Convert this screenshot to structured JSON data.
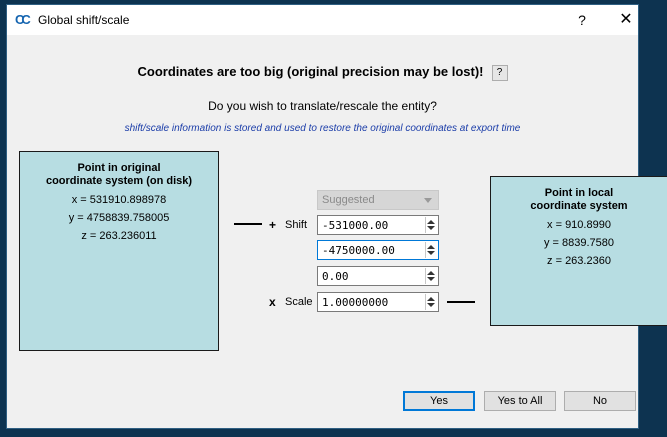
{
  "window": {
    "title": "Global shift/scale",
    "help_label": "?",
    "close_label": "✕",
    "icon": "cloudcompare-logo-icon"
  },
  "header": {
    "headline": "Coordinates are too big (original precision may be lost)!",
    "help_button_label": "?",
    "question": "Do you wish to translate/rescale the entity?",
    "info": "shift/scale information is stored and used to restore the original coordinates at export time"
  },
  "original": {
    "title_line1": "Point in original",
    "title_line2": "coordinate system (on disk)",
    "x": "x = 531910.898978",
    "y": "y = 4758839.758005",
    "z": "z = 263.236011"
  },
  "local": {
    "title_line1": "Point in local",
    "title_line2": "coordinate system",
    "x": "x = 910.8990",
    "y": "y = 8839.7580",
    "z": "z = 263.2360"
  },
  "controls": {
    "preset": "Suggested",
    "shift_symbol": "+",
    "shift_label": "Shift",
    "shift_x": "-531000.00",
    "shift_y": "-4750000.00",
    "shift_z": "0.00",
    "scale_symbol": "x",
    "scale_label": "Scale",
    "scale": "1.00000000"
  },
  "buttons": {
    "yes": "Yes",
    "yes_to_all": "Yes to All",
    "no": "No"
  }
}
